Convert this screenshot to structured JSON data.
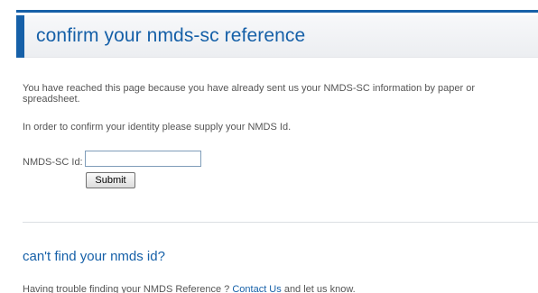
{
  "header": {
    "title": "confirm your nmds-sc reference"
  },
  "intro_text": "You have reached this page because you have already sent us your NMDS-SC information by paper or spreadsheet.",
  "identity_text": "In order to confirm your identity please supply your NMDS Id.",
  "form": {
    "id_label": "NMDS-SC Id:",
    "id_value": "",
    "submit_label": "Submit"
  },
  "help": {
    "heading": "can't find your nmds id?",
    "text_before": "Having trouble finding your NMDS Reference ? ",
    "link_label": "Contact Us",
    "text_after": " and let us know."
  },
  "colors": {
    "accent": "#1660a8",
    "body_text": "#555555"
  }
}
